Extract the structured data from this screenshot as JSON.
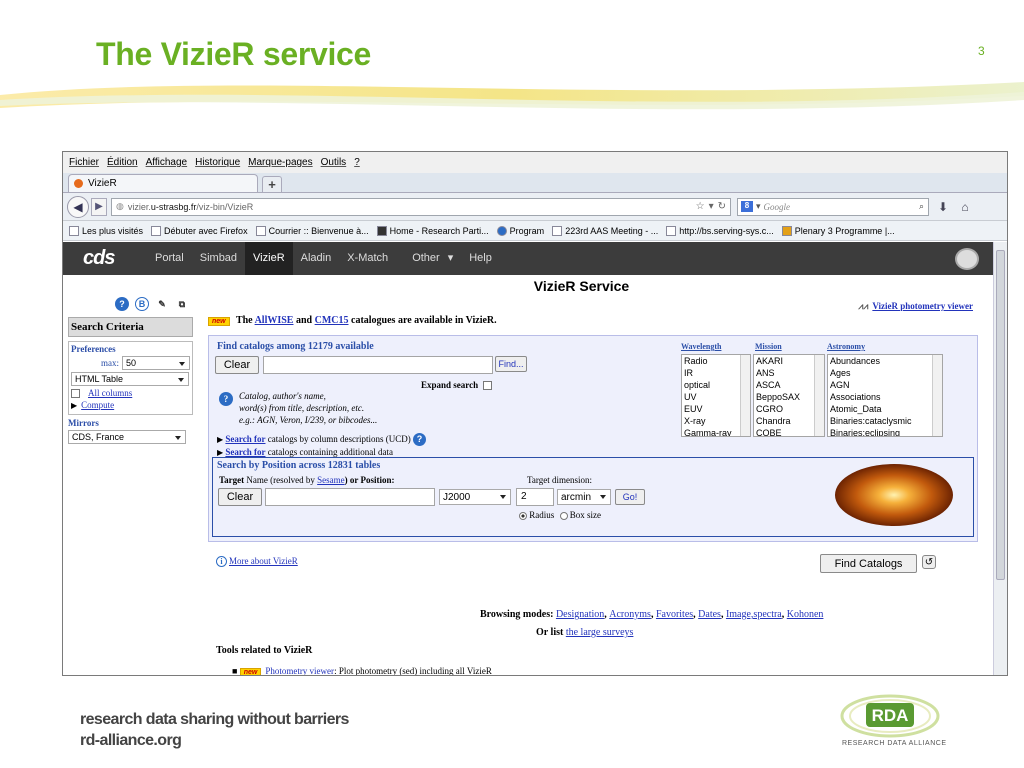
{
  "slide": {
    "title": "The VizieR service",
    "page_number": "3",
    "footer_line1": "research data sharing without barriers",
    "footer_line2": "rd-alliance.org",
    "logo_text": "RDA",
    "logo_caption": "RESEARCH DATA ALLIANCE",
    "accent_color": "#6ab023"
  },
  "browser": {
    "menu": [
      "Fichier",
      "Édition",
      "Affichage",
      "Historique",
      "Marque-pages",
      "Outils",
      "?"
    ],
    "tab_title": "VizieR",
    "new_tab": "+",
    "url_prefix": "vizier.",
    "url_domain": "u-strasbg.fr",
    "url_path": "/viz-bin/VizieR",
    "search_engine": "8",
    "search_placeholder": "Google",
    "bookmarks": [
      "Les plus visités",
      "Débuter avec Firefox",
      "Courrier :: Bienvenue à...",
      "Home - Research Parti...",
      "Program",
      "223rd AAS Meeting - ...",
      "http://bs.serving-sys.c...",
      "Plenary 3 Programme |..."
    ]
  },
  "cds": {
    "logo": "cds",
    "nav": [
      "Portal",
      "Simbad",
      "VizieR",
      "Aladin",
      "X-Match",
      "Other",
      "Help"
    ],
    "active": "VizieR"
  },
  "vizier": {
    "title": "VizieR Service",
    "photometry_viewer": "VizieR photometry viewer",
    "new_badge": "new",
    "announce_pre": "The",
    "announce_allwise": "AllWISE",
    "announce_and": "and",
    "announce_cmc15": "CMC15",
    "announce_post": "catalogues are available in VizieR.",
    "find_heading": "Find catalogs among 12179 available",
    "clear": "Clear",
    "find": "Find...",
    "expand_search": "Expand search",
    "catalog_line1": "Catalog, author's name,",
    "catalog_line2": "word(s) from title, description, etc.",
    "catalog_line3": "e.g.: AGN, Veron, I/239, or bibcodes...",
    "search_for": "Search for",
    "search_cols": "catalogs by column descriptions (UCD)",
    "search_add": "catalogs containing additional data",
    "wavelength_h": "Wavelength",
    "mission_h": "Mission",
    "astronomy_h": "Astronomy",
    "wavelength": [
      "Radio",
      "IR",
      "optical",
      "UV",
      "EUV",
      "X-ray",
      "Gamma-ray"
    ],
    "mission": [
      "AKARI",
      "ANS",
      "ASCA",
      "BeppoSAX",
      "CGRO",
      "Chandra",
      "COBE"
    ],
    "astronomy": [
      "Abundances",
      "Ages",
      "AGN",
      "Associations",
      "Atomic_Data",
      "Binaries:cataclysmic",
      "Binaries:eclipsing"
    ],
    "pos_heading": "Search by Position across 12831 tables",
    "target_label": "Target",
    "target_name": "Name (resolved by",
    "sesame": "Sesame",
    "or_position": ") or Position:",
    "target_dim": "Target dimension:",
    "epoch": "J2000",
    "dim_value": "2",
    "unit": "arcmin",
    "go": "Go!",
    "radius": "Radius",
    "box_size": "Box size",
    "more_about": "More about VizieR",
    "find_catalogs": "Find Catalogs",
    "browsing_label": "Browsing modes:",
    "browsing": [
      "Designation",
      "Acronyms",
      "Favorites",
      "Dates",
      "Image,spectra",
      "Kohonen"
    ],
    "or_list": "Or list",
    "large_surveys": "the large surveys",
    "tools_heading": "Tools related to VizieR",
    "photometry_item": "Photometry viewer",
    "photometry_desc": ": Plot photometry (sed) including all VizieR"
  },
  "left": {
    "search_criteria": "Search Criteria",
    "preferences": "Preferences",
    "max_label": "max:",
    "max_value": "50",
    "format": "HTML Table",
    "all_columns": "All columns",
    "compute": "Compute",
    "mirrors": "Mirrors",
    "mirror_value": "CDS, France"
  }
}
